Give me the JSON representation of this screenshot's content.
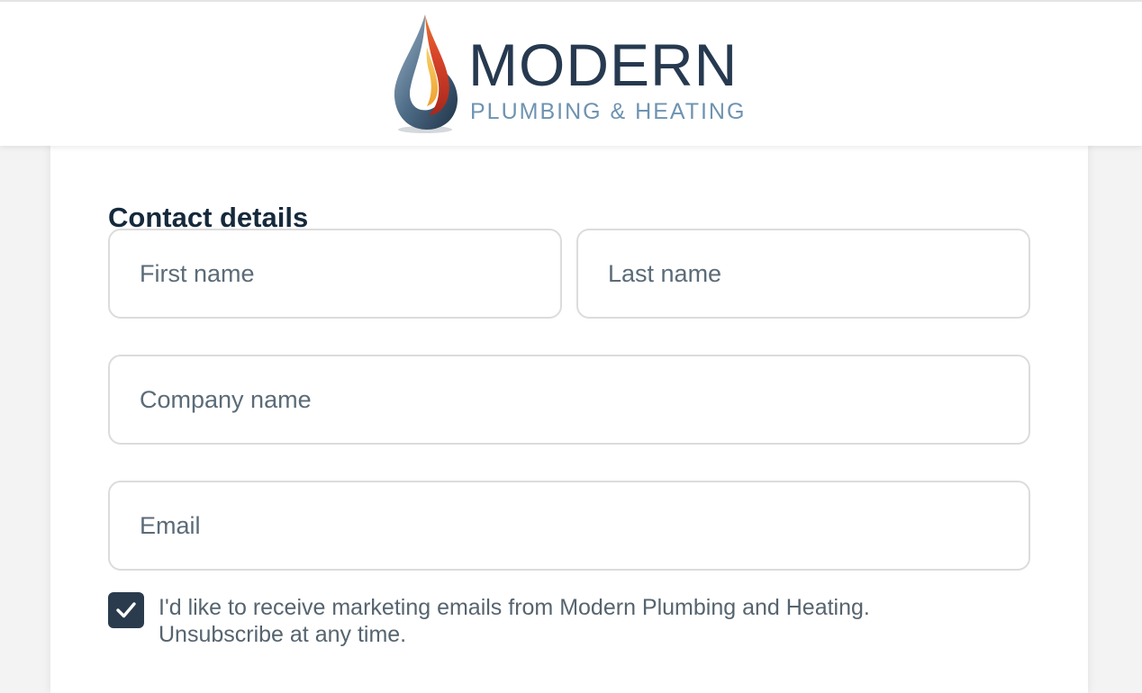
{
  "header": {
    "logo_title": "MODERN",
    "logo_subtitle": "PLUMBING & HEATING"
  },
  "form": {
    "section_title": "Contact details",
    "fields": {
      "first_name": {
        "placeholder": "First name",
        "value": ""
      },
      "last_name": {
        "placeholder": "Last name",
        "value": ""
      },
      "company_name": {
        "placeholder": "Company name",
        "value": ""
      },
      "email": {
        "placeholder": "Email",
        "value": ""
      }
    },
    "marketing_consent": {
      "checked": true,
      "line1": "I'd like to receive marketing emails from Modern Plumbing and Heating.",
      "line2": "Unsubscribe at any time."
    }
  },
  "icons": {
    "logo": "water-flame-drop-icon",
    "checkbox": "checkmark-icon"
  },
  "colors": {
    "brand_dark": "#26394f",
    "brand_light": "#6f93b1",
    "flame_red": "#c0392b",
    "flame_orange": "#f39c12",
    "checkbox_fill": "#2a3b4d"
  }
}
